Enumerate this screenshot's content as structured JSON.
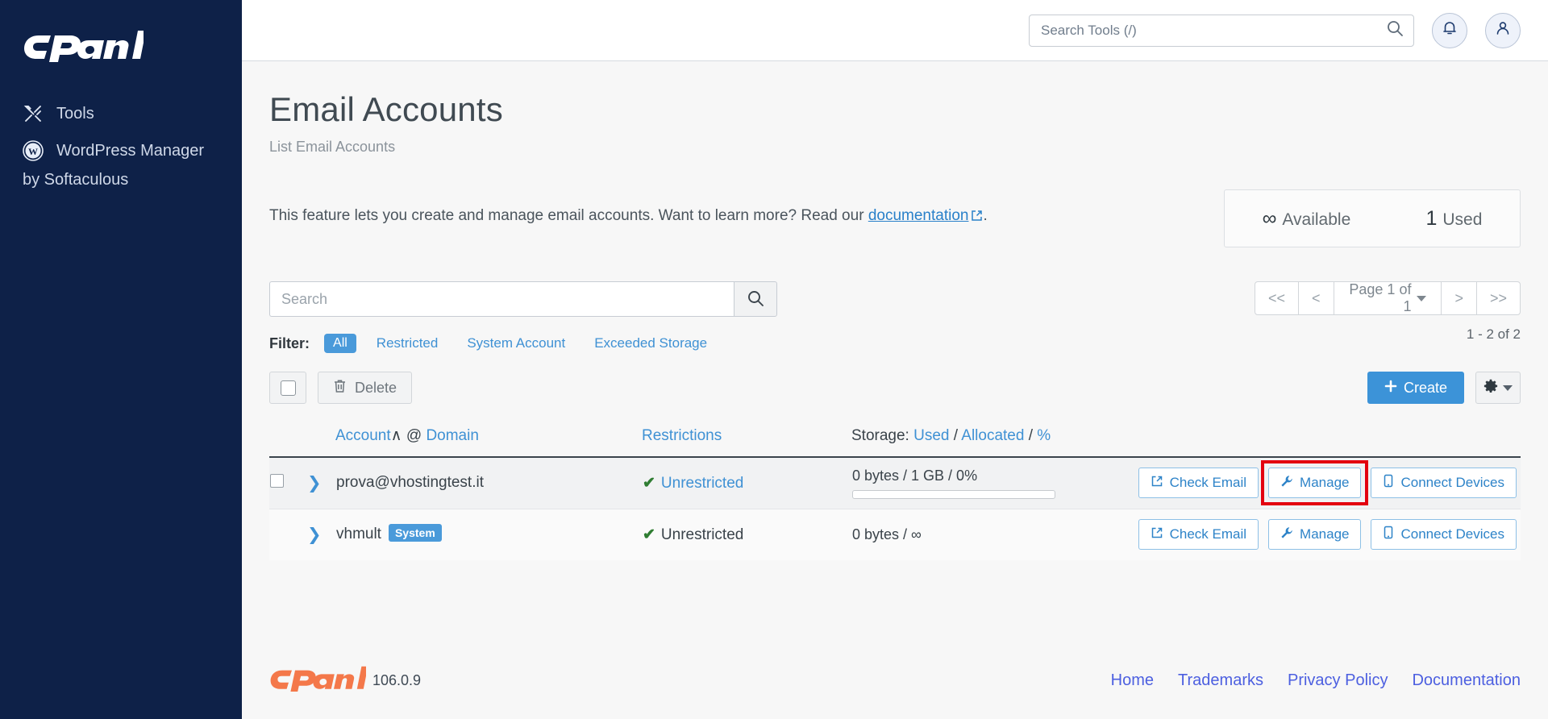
{
  "sidebar": {
    "logo_text": "cPanel",
    "items": [
      {
        "label": "Tools",
        "icon": "tools-icon"
      },
      {
        "label": "WordPress Manager",
        "icon": "wordpress-icon"
      }
    ],
    "sub_label": "by Softaculous"
  },
  "topbar": {
    "search_placeholder": "Search Tools (/)",
    "search_value": "",
    "notifications_icon": "bell-icon",
    "account_icon": "user-icon"
  },
  "page": {
    "title": "Email Accounts",
    "subtitle": "List Email Accounts",
    "description_before": "This feature lets you create and manage email accounts. Want to learn more? Read our ",
    "description_link": "documentation",
    "description_after": "."
  },
  "quota": {
    "available_value": "∞",
    "available_label": "Available",
    "used_value": "1",
    "used_label": "Used"
  },
  "search": {
    "placeholder": "Search",
    "value": "",
    "icon": "search-icon"
  },
  "filter": {
    "label": "Filter:",
    "options": [
      {
        "label": "All",
        "active": true
      },
      {
        "label": "Restricted",
        "active": false
      },
      {
        "label": "System Account",
        "active": false
      },
      {
        "label": "Exceeded Storage",
        "active": false
      }
    ]
  },
  "pagination": {
    "first": "<<",
    "prev": "<",
    "page_label": "Page 1 of 1",
    "next": ">",
    "last": ">>",
    "range": "1 - 2 of 2"
  },
  "toolbar": {
    "delete_label": "Delete",
    "delete_icon": "trash-icon",
    "create_label": "Create",
    "create_icon": "plus-icon",
    "settings_icon": "gear-icon"
  },
  "table": {
    "headers": {
      "account": "Account",
      "sort_indicator": "∧",
      "at": "@",
      "domain": "Domain",
      "restrictions": "Restrictions",
      "storage_prefix": "Storage:",
      "storage_used": "Used",
      "storage_sep1": "/",
      "storage_allocated": "Allocated",
      "storage_sep2": "/",
      "storage_percent": "%"
    },
    "rows": [
      {
        "account": "prova@vhostingtest.it",
        "badge": "",
        "restriction": "Unrestricted",
        "storage": "0 bytes / 1 GB / 0%",
        "has_bar": true,
        "bar_percent": 0,
        "highlighted_action": "Manage",
        "actions": [
          {
            "label": "Check Email",
            "icon": "external-link-icon"
          },
          {
            "label": "Manage",
            "icon": "wrench-icon"
          },
          {
            "label": "Connect Devices",
            "icon": "mobile-icon"
          }
        ]
      },
      {
        "account": "vhmult",
        "badge": "System",
        "restriction": "Unrestricted",
        "storage": "0 bytes / ∞",
        "has_bar": false,
        "bar_percent": 0,
        "highlighted_action": "",
        "actions": [
          {
            "label": "Check Email",
            "icon": "external-link-icon"
          },
          {
            "label": "Manage",
            "icon": "wrench-icon"
          },
          {
            "label": "Connect Devices",
            "icon": "mobile-icon"
          }
        ]
      }
    ]
  },
  "footer": {
    "logo_text": "cPanel",
    "version": "106.0.9",
    "links": [
      "Home",
      "Trademarks",
      "Privacy Policy",
      "Documentation"
    ]
  },
  "colors": {
    "sidebar_bg": "#0e2148",
    "accent_blue": "#3c93d8",
    "link_blue": "#3f91d4",
    "highlight_red": "#e3000f",
    "cpanel_orange": "#f4784a",
    "check_green": "#2f7d32"
  }
}
